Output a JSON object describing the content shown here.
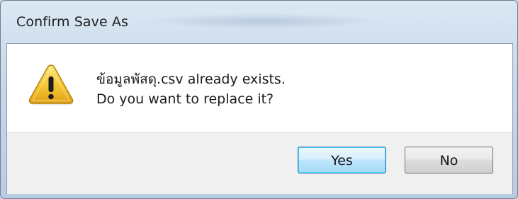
{
  "window": {
    "title": "Confirm Save As"
  },
  "message": {
    "line1": "ข้อมูลพัสดุ.csv already exists.",
    "line2": "Do you want to replace it?"
  },
  "icon": {
    "name": "warning-icon",
    "color": "#f2c12e"
  },
  "buttons": {
    "yes_label": "Yes",
    "no_label": "No",
    "default": "yes"
  },
  "colors": {
    "titlebar": "#c7d8ea",
    "footer": "#f0f0f0",
    "default_button_border": "#3c7fb1"
  }
}
